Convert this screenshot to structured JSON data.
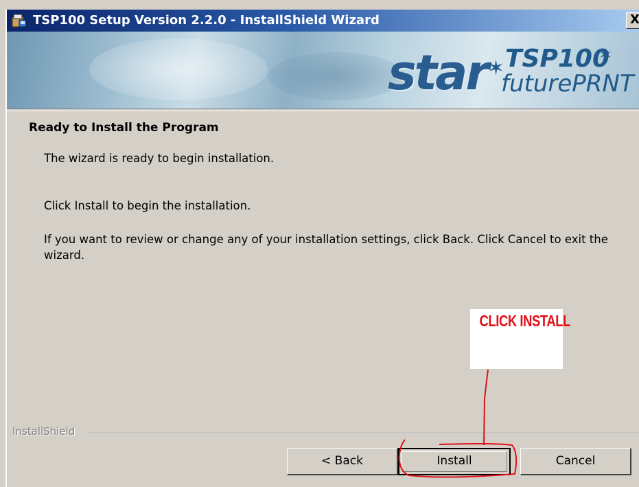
{
  "window": {
    "title": "TSP100 Setup Version 2.2.0 - InstallShield Wizard",
    "close_label": "X"
  },
  "banner": {
    "logo_star": "star",
    "logo_model": "TSP100",
    "logo_sub": "futurePRNT"
  },
  "content": {
    "heading": "Ready to Install the Program",
    "para1": "The wizard is ready to begin installation.",
    "para2": "Click Install to begin the installation.",
    "para3": "If you want to review or change any of your installation settings, click Back. Click Cancel to exit the wizard."
  },
  "annotation": {
    "text": "CLICK INSTALL",
    "color": "#e0101a"
  },
  "footer": {
    "brand": "InstallShield",
    "back_label": "< Back",
    "install_label": "Install",
    "cancel_label": "Cancel"
  }
}
